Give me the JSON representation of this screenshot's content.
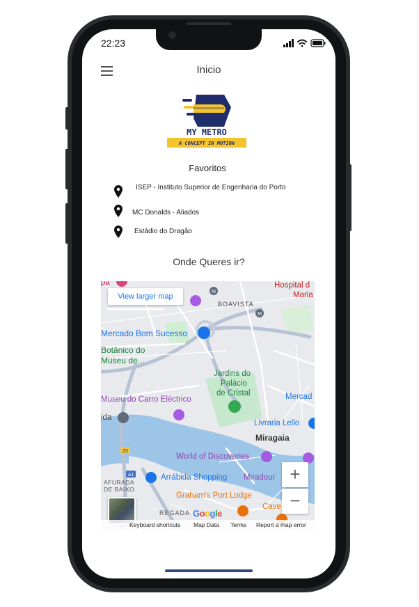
{
  "status_bar": {
    "time": "22:23"
  },
  "header": {
    "title": "Inicio"
  },
  "logo": {
    "name": "MY METRO",
    "tagline": "A CONCEPT IN MOTION"
  },
  "favorites": {
    "title": "Favoritos",
    "items": [
      {
        "label": "ISEP - Instituto Superior de Engenharia do Porto"
      },
      {
        "label": "MC Donalds - Aliados"
      },
      {
        "label": "Estádio do Dragão"
      }
    ]
  },
  "destination": {
    "prompt": "Onde Queres ir?"
  },
  "map": {
    "view_larger": "View larger map",
    "zoom_in": "+",
    "zoom_out": "−",
    "google": "Google",
    "attribution": {
      "shortcuts": "Keyboard shortcuts",
      "map_data": "Map Data",
      "terms": "Terms",
      "report": "Report a map error"
    },
    "labels": {
      "hospital": "Hospital d",
      "maria": "Maria",
      "pa": "pa",
      "boavista": "BOAVISTA",
      "mercado": "Mercado Bom Sucesso",
      "botanico1": "Botânico do",
      "botanico2": "Museu de...",
      "jardins1": "Jardins do",
      "jardins2": "Palácio",
      "jardins3": "de Cristal",
      "museu_carro": "Museu do Carro Eléctrico",
      "mercado_right": "Mercad",
      "ida": "ida",
      "livraria": "Livraria Lello",
      "miragaia": "Miragaia",
      "world": "World of Discoveries",
      "arrabida": "Arrábida Shopping",
      "miradouro": "Miradour",
      "afurada1": "AFURADA",
      "afurada2": "DE BAIXO",
      "grahams": "Graham's Port Lodge",
      "regada": "REGADA",
      "cave": "Cave",
      "a1": "A1",
      "r23": "23",
      "m": "M"
    }
  },
  "colors": {
    "phone_frame": "#2a2b2e",
    "map_water": "#9dc5e8",
    "map_land": "#e9eaee",
    "map_park": "#c6e8cd",
    "poi_blue": "#1a73e8",
    "poi_purple": "#a55ce0",
    "poi_pink": "#d6457c",
    "poi_orange": "#e8710a",
    "logo_navy": "#1f2d6b",
    "logo_yellow": "#f4c430",
    "home_indicator": "#2c4a7a"
  },
  "icons": [
    "menu-icon",
    "location-pin-icon",
    "signal-icon",
    "wifi-icon",
    "battery-icon"
  ]
}
